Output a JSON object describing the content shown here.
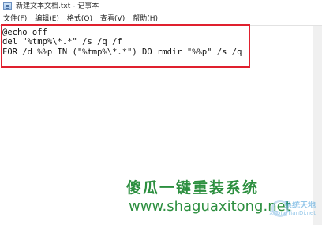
{
  "window": {
    "title": "新建文本文档.txt - 记事本",
    "icon": "notepad-icon"
  },
  "menu": {
    "items": [
      {
        "label": "文件(F)"
      },
      {
        "label": "编辑(E)"
      },
      {
        "label": "格式(O)"
      },
      {
        "label": "查看(V)"
      },
      {
        "label": "帮助(H)"
      }
    ]
  },
  "editor": {
    "lines": [
      "@echo off",
      "del \"%tmp%\\*.*\" /s /q /f",
      "FOR /d %%p IN (\"%tmp%\\*.*\") DO rmdir \"%%p\" /s /q"
    ]
  },
  "watermark": {
    "title": "傻瓜一键重装系统",
    "url": "www.shaguaxitong.net",
    "logo_text": "系统天地",
    "logo_sub": "XiTongTianDi.net"
  },
  "colors": {
    "highlight": "#e0202e",
    "watermark": "#2c8f3f",
    "logo": "#3f9bd8"
  }
}
